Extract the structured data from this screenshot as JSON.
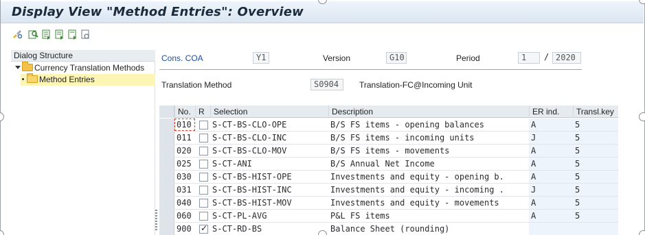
{
  "window": {
    "title": "Display View \"Method Entries\": Overview"
  },
  "toolbar": {
    "buttons": [
      {
        "icon": "display-change-icon",
        "color": "#e6b23a"
      },
      {
        "icon": "details-icon",
        "color": "#3e8a3a"
      },
      {
        "icon": "first-entry-icon",
        "color": "#3e8a3a"
      },
      {
        "icon": "previous-entry-icon",
        "color": "#3e8a3a"
      },
      {
        "icon": "next-entry-icon",
        "color": "#3e8a3a"
      },
      {
        "icon": "last-entry-icon",
        "color": "#3e8a3a"
      }
    ]
  },
  "dialog_structure": {
    "header": "Dialog Structure",
    "items": [
      {
        "label": "Currency Translation Methods"
      },
      {
        "label": "Method Entries"
      }
    ]
  },
  "header_fields": {
    "cons_coa_label": "Cons. COA",
    "cons_coa_value": "Y1",
    "version_label": "Version",
    "version_value": "G10",
    "period_label": "Period",
    "period_value": "1",
    "period_sep": "/",
    "year_value": "2020",
    "translation_method_label": "Translation Method",
    "translation_method_value": "S0904",
    "translation_method_desc": "Translation-FC@Incoming Unit"
  },
  "table": {
    "columns": [
      "No.",
      "R",
      "Selection",
      "Description",
      "ER ind.",
      "Transl.key"
    ],
    "rows": [
      {
        "no": "010",
        "r": false,
        "selection": "S-CT-BS-CLO-OPE",
        "description": "B/S FS items - opening balances",
        "er": "A",
        "key": "5"
      },
      {
        "no": "011",
        "r": false,
        "selection": "S-CT-BS-CLO-INC",
        "description": "B/S FS items - incoming units",
        "er": "J",
        "key": "5"
      },
      {
        "no": "020",
        "r": false,
        "selection": "S-CT-BS-CLO-MOV",
        "description": "B/S FS items - movements",
        "er": "A",
        "key": "5"
      },
      {
        "no": "025",
        "r": false,
        "selection": "S-CT-ANI",
        "description": "B/S Annual Net Income",
        "er": "A",
        "key": "5"
      },
      {
        "no": "030",
        "r": false,
        "selection": "S-CT-BS-HIST-OPE",
        "description": "Investments and equity - opening b.",
        "er": "A",
        "key": "5"
      },
      {
        "no": "031",
        "r": false,
        "selection": "S-CT-BS-HIST-INC",
        "description": "Investments and equity - incoming .",
        "er": "J",
        "key": "5"
      },
      {
        "no": "040",
        "r": false,
        "selection": "S-CT-BS-HIST-MOV",
        "description": "Investments and equity - movements",
        "er": "A",
        "key": "5"
      },
      {
        "no": "060",
        "r": false,
        "selection": "S-CT-PL-AVG",
        "description": "P&L FS items",
        "er": "A",
        "key": "5"
      },
      {
        "no": "900",
        "r": true,
        "selection": "S-CT-RD-BS",
        "description": "Balance Sheet (rounding)",
        "er": "",
        "key": ""
      }
    ]
  }
}
